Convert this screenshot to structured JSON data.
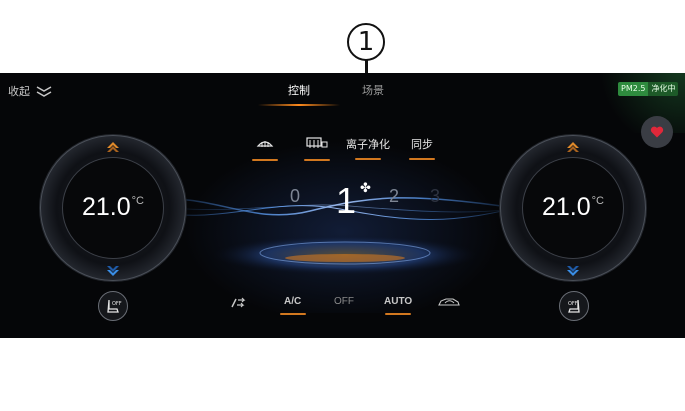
{
  "callout": {
    "number": "1"
  },
  "header": {
    "collapse_label": "收起",
    "tabs": [
      {
        "label": "控制",
        "active": true
      },
      {
        "label": "场景",
        "active": false
      }
    ],
    "pm_badge": {
      "label": "PM2.5",
      "status": "净化中"
    }
  },
  "features": [
    {
      "icon": "front-defrost-icon"
    },
    {
      "icon": "rear-defrost-icon"
    },
    {
      "label": "离子净化"
    },
    {
      "label": "同步"
    }
  ],
  "left_zone": {
    "temperature": "21.0",
    "unit": "°C"
  },
  "right_zone": {
    "temperature": "21.0",
    "unit": "°C"
  },
  "fan": {
    "levels": [
      "0",
      "1",
      "2",
      "3"
    ],
    "current": "1"
  },
  "bottom": {
    "left_seat_heat": "OFF",
    "right_seat_heat": "OFF",
    "ac_label": "A/C",
    "off_label": "OFF",
    "auto_label": "AUTO"
  },
  "colors": {
    "accent": "#d2781f",
    "up_arrow": "#e08a2a",
    "down_arrow": "#3a8ee6",
    "favorite": "#e0283a",
    "pm_badge": "#2e8b3e"
  }
}
